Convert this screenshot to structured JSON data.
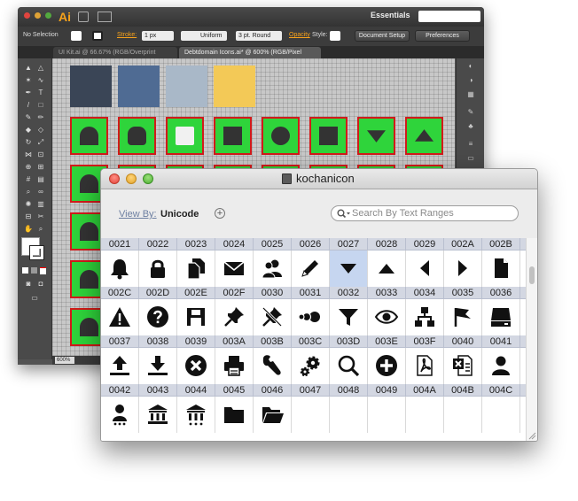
{
  "illustrator": {
    "app_logo": "Ai",
    "workspace": "Essentials",
    "control_bar": {
      "selection": "No Selection",
      "stroke_label": "Stroke:",
      "stroke_value": "1 px",
      "profile": "Uniform",
      "brush": "3 pt. Round",
      "opacity_label": "Opacity",
      "style_label": "Style:",
      "document_setup": "Document Setup",
      "preferences": "Preferences"
    },
    "tabs": [
      {
        "label": "UI Kit.ai @ 66.67% (RGB/Overprint Preview)"
      },
      {
        "label": "Debtdomain Icons.ai* @ 600% (RGB/Pixel Preview)"
      }
    ],
    "zoom": "600%",
    "swatch_colors": [
      "#3a4556",
      "#4f6b93",
      "#a9b8c8",
      "#f3c957"
    ]
  },
  "kochanicon": {
    "title": "kochanicon",
    "view_by_label": "View By:",
    "view_by_value": "Unicode",
    "search_placeholder": "Search By Text Ranges",
    "selected_code": "0027",
    "code_rows": [
      [
        "0021",
        "0022",
        "0023",
        "0024",
        "0025",
        "0026",
        "0027",
        "0028",
        "0029",
        "002A",
        "002B"
      ],
      [
        "002C",
        "002D",
        "002E",
        "002F",
        "0030",
        "0031",
        "0032",
        "0033",
        "0034",
        "0035",
        "0036"
      ],
      [
        "0037",
        "0038",
        "0039",
        "003A",
        "003B",
        "003C",
        "003D",
        "003E",
        "003F",
        "0040",
        "0041"
      ],
      [
        "0042",
        "0043",
        "0044",
        "0045",
        "0046",
        "0047",
        "0048",
        "0049",
        "004A",
        "004B",
        "004C"
      ]
    ],
    "glyph_rows": [
      [
        "bell-icon",
        "lock-icon",
        "documents-icon",
        "envelope-icon",
        "users-icon",
        "pencil-icon",
        "caret-down-icon",
        "caret-up-icon",
        "caret-left-icon",
        "caret-right-icon",
        "document-icon"
      ],
      [
        "warning-icon",
        "help-icon",
        "save-icon",
        "pin-icon",
        "unpin-icon",
        "dots-icon",
        "filter-icon",
        "eye-icon",
        "sitemap-icon",
        "flag-icon",
        "hard-drive-icon"
      ],
      [
        "upload-icon",
        "download-icon",
        "close-circle-icon",
        "printer-icon",
        "wrench-icon",
        "gears-icon",
        "search-icon",
        "add-circle-icon",
        "pdf-icon",
        "excel-icon",
        "user-icon"
      ],
      [
        "user-alt-icon",
        "bank-icon",
        "bank-alt-icon",
        "folder-icon",
        "folder-open-icon",
        "",
        "",
        "",
        "",
        "",
        ""
      ]
    ]
  }
}
